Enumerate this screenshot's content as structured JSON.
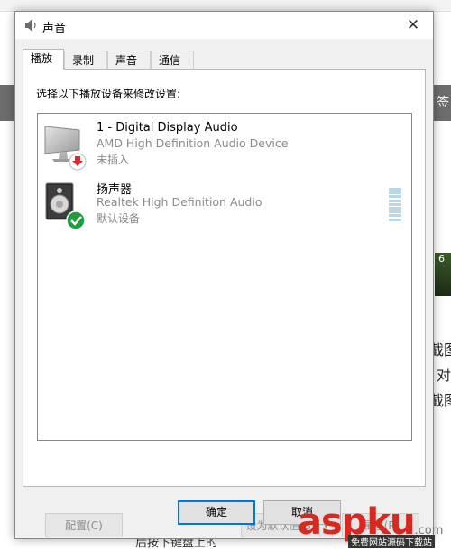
{
  "window": {
    "title": "声音",
    "title_icon": "speaker-icon",
    "close_glyph": "✕"
  },
  "tabs": [
    {
      "label": "播放",
      "active": true
    },
    {
      "label": "录制",
      "active": false
    },
    {
      "label": "声音",
      "active": false
    },
    {
      "label": "通信",
      "active": false
    }
  ],
  "instruction": "选择以下播放设备来修改设置:",
  "devices": [
    {
      "name": "1 - Digital Display Audio",
      "description": "AMD High Definition Audio Device",
      "status": "未插入",
      "icon": "monitor-icon",
      "badge": "unplugged-arrow-icon"
    },
    {
      "name": "扬声器",
      "description": "Realtek High Definition Audio",
      "status": "默认设备",
      "icon": "speaker-icon",
      "badge": "default-check-icon"
    }
  ],
  "buttons": {
    "configure": "配置(C)",
    "set_default": "设为默认值(S)",
    "set_default_arrow": "▼",
    "properties": "属性(P)",
    "ok": "确定",
    "cancel": "取消"
  },
  "background": {
    "right_strip_top": "签",
    "right_lines": [
      "截图",
      "对",
      "截图"
    ],
    "thumb_label": "6",
    "bottom_text": "后按下键盘上的",
    "watermark": "aspku",
    "watermark_tld": ".com",
    "watermark_sub": "免费网站源码下载站"
  },
  "colors": {
    "accent": "#0078d7",
    "check_green": "#1e9e3c",
    "unplugged_red": "#d92b2b",
    "level_meter": "#b9d8e6",
    "watermark_red": "#d9281f"
  }
}
